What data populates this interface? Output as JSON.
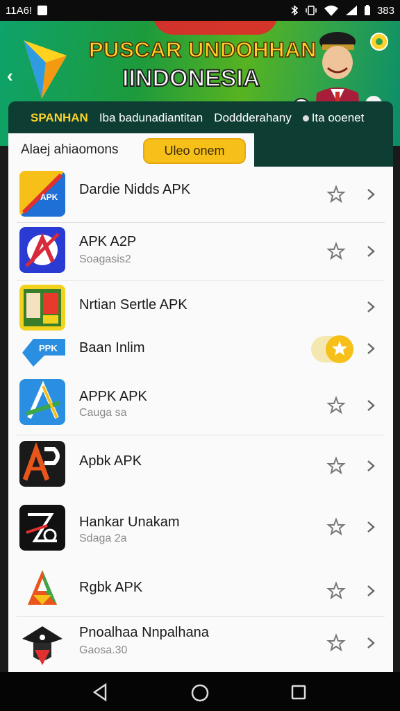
{
  "status": {
    "time": "11A6!",
    "battery": "383"
  },
  "banner": {
    "title1": "PUSCAR UNDOHHAN",
    "title2": "IINDONESIA"
  },
  "tabs": [
    {
      "label": "SPANHAN",
      "active": true
    },
    {
      "label": "Iba badunadiantitan",
      "active": false
    },
    {
      "label": "Doddderahany",
      "active": false
    },
    {
      "label": "Ita ooenet",
      "active": false
    }
  ],
  "panel": {
    "heading": "Alaej ahiaomons",
    "pill": "Uleo onem"
  },
  "apps": [
    {
      "name": "Dardie Nidds APK",
      "sub": ""
    },
    {
      "name": "APK A2P",
      "sub": "Soagasis2"
    },
    {
      "name": "Nrtian Sertle APK",
      "sub": ""
    },
    {
      "name": "Baan Inlim",
      "sub": ""
    },
    {
      "name": "APPK APK",
      "sub": "Cauga sa"
    },
    {
      "name": "Apbk APK",
      "sub": ""
    },
    {
      "name": "Hankar Unakam",
      "sub": "Sdaga 2a"
    },
    {
      "name": "Rgbk APK",
      "sub": ""
    },
    {
      "name": "Pnoalhaa Nnpalhana",
      "sub": "Gaosa.30"
    }
  ],
  "colors": {
    "accent": "#f6c019",
    "dark_header": "#0e3d34"
  }
}
